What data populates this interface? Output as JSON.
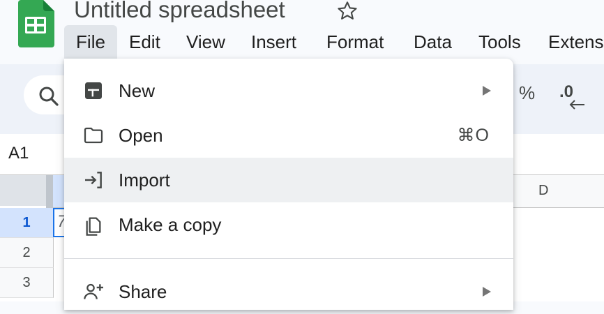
{
  "app": {
    "doc_title": "Untitled spreadsheet",
    "logo_icon": "google-sheets-logo",
    "brand_color": "#34a853"
  },
  "menubar": {
    "items": [
      "File",
      "Edit",
      "View",
      "Insert",
      "Format",
      "Data",
      "Tools",
      "Extens"
    ],
    "active": "File"
  },
  "toolbar": {
    "percent_label": "%",
    "decimal_label": ".0"
  },
  "name_box": {
    "cell_ref": "A1"
  },
  "grid": {
    "visible_column_header": "D",
    "row_numbers": [
      "1",
      "2",
      "3"
    ],
    "selected_row": "1",
    "active_cell_partial_text": "7"
  },
  "file_menu": {
    "items": [
      {
        "label": "New",
        "icon": "new-sheet-icon",
        "shortcut": "",
        "submenu": true
      },
      {
        "label": "Open",
        "icon": "folder-icon",
        "shortcut": "⌘O",
        "submenu": false
      },
      {
        "label": "Import",
        "icon": "import-icon",
        "shortcut": "",
        "submenu": false,
        "hovered": true
      },
      {
        "label": "Make a copy",
        "icon": "copy-icon",
        "shortcut": "",
        "submenu": false
      },
      {
        "label": "Share",
        "icon": "share-person-icon",
        "shortcut": "",
        "submenu": true
      }
    ]
  }
}
